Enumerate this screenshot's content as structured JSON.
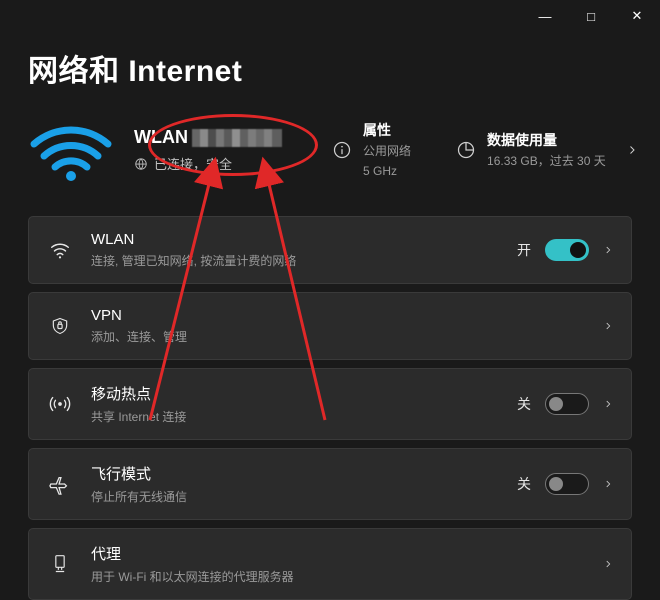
{
  "titlebar": {
    "min": "—",
    "max": "□",
    "close": "✕"
  },
  "page_title": "网络和 Internet",
  "hero": {
    "ssid_prefix": "WLAN",
    "status": "已连接，安全",
    "properties": {
      "title": "属性",
      "sub1": "公用网络",
      "sub2": "5 GHz"
    },
    "usage": {
      "title": "数据使用量",
      "sub": "16.33 GB，过去 30 天"
    }
  },
  "items": [
    {
      "title": "WLAN",
      "sub": "连接, 管理已知网络, 按流量计费的网络",
      "state": "开",
      "toggle": "on"
    },
    {
      "title": "VPN",
      "sub": "添加、连接、管理"
    },
    {
      "title": "移动热点",
      "sub": "共享 Internet 连接",
      "state": "关",
      "toggle": "off"
    },
    {
      "title": "飞行模式",
      "sub": "停止所有无线通信",
      "state": "关",
      "toggle": "off"
    },
    {
      "title": "代理",
      "sub": "用于 Wi-Fi 和以太网连接的代理服务器"
    }
  ]
}
